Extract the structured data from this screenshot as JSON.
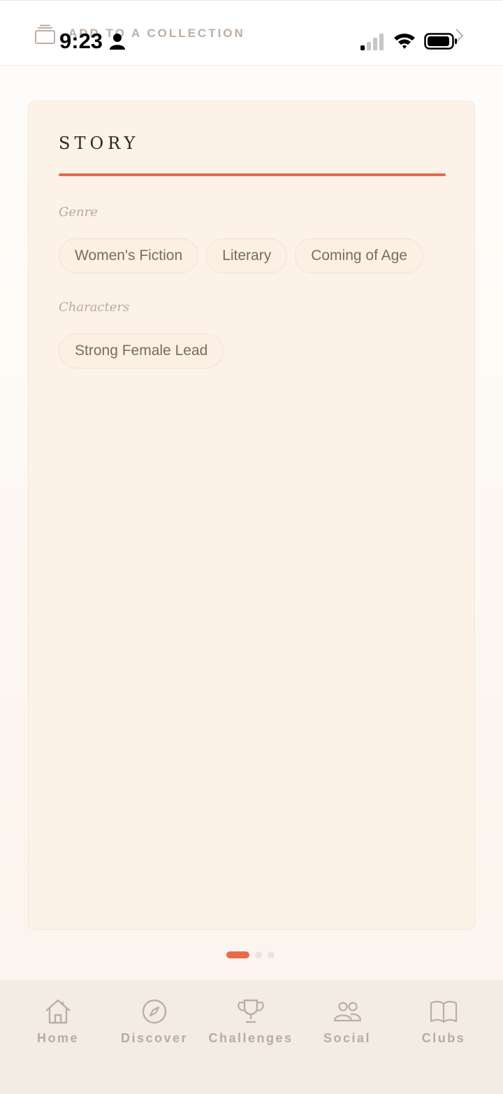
{
  "status_bar": {
    "time": "9:23"
  },
  "header": {
    "collection_label": "ADD TO A COLLECTION",
    "icons": [
      "collection-icon",
      "chevron-right-icon"
    ]
  },
  "card": {
    "title": "STORY",
    "accent_color": "#e56b4c",
    "sections": [
      {
        "label": "Genre",
        "chips": [
          "Women's Fiction",
          "Literary",
          "Coming of Age"
        ]
      },
      {
        "label": "Characters",
        "chips": [
          "Strong Female Lead"
        ]
      }
    ]
  },
  "pagination": {
    "page_count": 3,
    "current_page": 1
  },
  "bottom_nav": {
    "items": [
      {
        "label": "Home",
        "icon": "home-icon"
      },
      {
        "label": "Discover",
        "icon": "compass-icon"
      },
      {
        "label": "Challenges",
        "icon": "trophy-icon"
      },
      {
        "label": "Social",
        "icon": "people-icon"
      },
      {
        "label": "Clubs",
        "icon": "book-icon"
      }
    ]
  }
}
